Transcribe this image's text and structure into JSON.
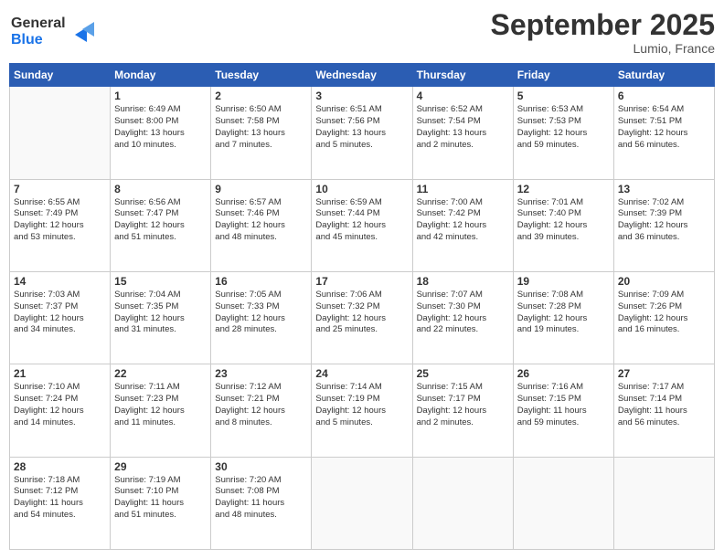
{
  "header": {
    "logo_line1": "General",
    "logo_line2": "Blue",
    "month": "September 2025",
    "location": "Lumio, France"
  },
  "days_of_week": [
    "Sunday",
    "Monday",
    "Tuesday",
    "Wednesday",
    "Thursday",
    "Friday",
    "Saturday"
  ],
  "weeks": [
    [
      {
        "day": "",
        "lines": []
      },
      {
        "day": "1",
        "lines": [
          "Sunrise: 6:49 AM",
          "Sunset: 8:00 PM",
          "Daylight: 13 hours",
          "and 10 minutes."
        ]
      },
      {
        "day": "2",
        "lines": [
          "Sunrise: 6:50 AM",
          "Sunset: 7:58 PM",
          "Daylight: 13 hours",
          "and 7 minutes."
        ]
      },
      {
        "day": "3",
        "lines": [
          "Sunrise: 6:51 AM",
          "Sunset: 7:56 PM",
          "Daylight: 13 hours",
          "and 5 minutes."
        ]
      },
      {
        "day": "4",
        "lines": [
          "Sunrise: 6:52 AM",
          "Sunset: 7:54 PM",
          "Daylight: 13 hours",
          "and 2 minutes."
        ]
      },
      {
        "day": "5",
        "lines": [
          "Sunrise: 6:53 AM",
          "Sunset: 7:53 PM",
          "Daylight: 12 hours",
          "and 59 minutes."
        ]
      },
      {
        "day": "6",
        "lines": [
          "Sunrise: 6:54 AM",
          "Sunset: 7:51 PM",
          "Daylight: 12 hours",
          "and 56 minutes."
        ]
      }
    ],
    [
      {
        "day": "7",
        "lines": [
          "Sunrise: 6:55 AM",
          "Sunset: 7:49 PM",
          "Daylight: 12 hours",
          "and 53 minutes."
        ]
      },
      {
        "day": "8",
        "lines": [
          "Sunrise: 6:56 AM",
          "Sunset: 7:47 PM",
          "Daylight: 12 hours",
          "and 51 minutes."
        ]
      },
      {
        "day": "9",
        "lines": [
          "Sunrise: 6:57 AM",
          "Sunset: 7:46 PM",
          "Daylight: 12 hours",
          "and 48 minutes."
        ]
      },
      {
        "day": "10",
        "lines": [
          "Sunrise: 6:59 AM",
          "Sunset: 7:44 PM",
          "Daylight: 12 hours",
          "and 45 minutes."
        ]
      },
      {
        "day": "11",
        "lines": [
          "Sunrise: 7:00 AM",
          "Sunset: 7:42 PM",
          "Daylight: 12 hours",
          "and 42 minutes."
        ]
      },
      {
        "day": "12",
        "lines": [
          "Sunrise: 7:01 AM",
          "Sunset: 7:40 PM",
          "Daylight: 12 hours",
          "and 39 minutes."
        ]
      },
      {
        "day": "13",
        "lines": [
          "Sunrise: 7:02 AM",
          "Sunset: 7:39 PM",
          "Daylight: 12 hours",
          "and 36 minutes."
        ]
      }
    ],
    [
      {
        "day": "14",
        "lines": [
          "Sunrise: 7:03 AM",
          "Sunset: 7:37 PM",
          "Daylight: 12 hours",
          "and 34 minutes."
        ]
      },
      {
        "day": "15",
        "lines": [
          "Sunrise: 7:04 AM",
          "Sunset: 7:35 PM",
          "Daylight: 12 hours",
          "and 31 minutes."
        ]
      },
      {
        "day": "16",
        "lines": [
          "Sunrise: 7:05 AM",
          "Sunset: 7:33 PM",
          "Daylight: 12 hours",
          "and 28 minutes."
        ]
      },
      {
        "day": "17",
        "lines": [
          "Sunrise: 7:06 AM",
          "Sunset: 7:32 PM",
          "Daylight: 12 hours",
          "and 25 minutes."
        ]
      },
      {
        "day": "18",
        "lines": [
          "Sunrise: 7:07 AM",
          "Sunset: 7:30 PM",
          "Daylight: 12 hours",
          "and 22 minutes."
        ]
      },
      {
        "day": "19",
        "lines": [
          "Sunrise: 7:08 AM",
          "Sunset: 7:28 PM",
          "Daylight: 12 hours",
          "and 19 minutes."
        ]
      },
      {
        "day": "20",
        "lines": [
          "Sunrise: 7:09 AM",
          "Sunset: 7:26 PM",
          "Daylight: 12 hours",
          "and 16 minutes."
        ]
      }
    ],
    [
      {
        "day": "21",
        "lines": [
          "Sunrise: 7:10 AM",
          "Sunset: 7:24 PM",
          "Daylight: 12 hours",
          "and 14 minutes."
        ]
      },
      {
        "day": "22",
        "lines": [
          "Sunrise: 7:11 AM",
          "Sunset: 7:23 PM",
          "Daylight: 12 hours",
          "and 11 minutes."
        ]
      },
      {
        "day": "23",
        "lines": [
          "Sunrise: 7:12 AM",
          "Sunset: 7:21 PM",
          "Daylight: 12 hours",
          "and 8 minutes."
        ]
      },
      {
        "day": "24",
        "lines": [
          "Sunrise: 7:14 AM",
          "Sunset: 7:19 PM",
          "Daylight: 12 hours",
          "and 5 minutes."
        ]
      },
      {
        "day": "25",
        "lines": [
          "Sunrise: 7:15 AM",
          "Sunset: 7:17 PM",
          "Daylight: 12 hours",
          "and 2 minutes."
        ]
      },
      {
        "day": "26",
        "lines": [
          "Sunrise: 7:16 AM",
          "Sunset: 7:15 PM",
          "Daylight: 11 hours",
          "and 59 minutes."
        ]
      },
      {
        "day": "27",
        "lines": [
          "Sunrise: 7:17 AM",
          "Sunset: 7:14 PM",
          "Daylight: 11 hours",
          "and 56 minutes."
        ]
      }
    ],
    [
      {
        "day": "28",
        "lines": [
          "Sunrise: 7:18 AM",
          "Sunset: 7:12 PM",
          "Daylight: 11 hours",
          "and 54 minutes."
        ]
      },
      {
        "day": "29",
        "lines": [
          "Sunrise: 7:19 AM",
          "Sunset: 7:10 PM",
          "Daylight: 11 hours",
          "and 51 minutes."
        ]
      },
      {
        "day": "30",
        "lines": [
          "Sunrise: 7:20 AM",
          "Sunset: 7:08 PM",
          "Daylight: 11 hours",
          "and 48 minutes."
        ]
      },
      {
        "day": "",
        "lines": []
      },
      {
        "day": "",
        "lines": []
      },
      {
        "day": "",
        "lines": []
      },
      {
        "day": "",
        "lines": []
      }
    ]
  ]
}
